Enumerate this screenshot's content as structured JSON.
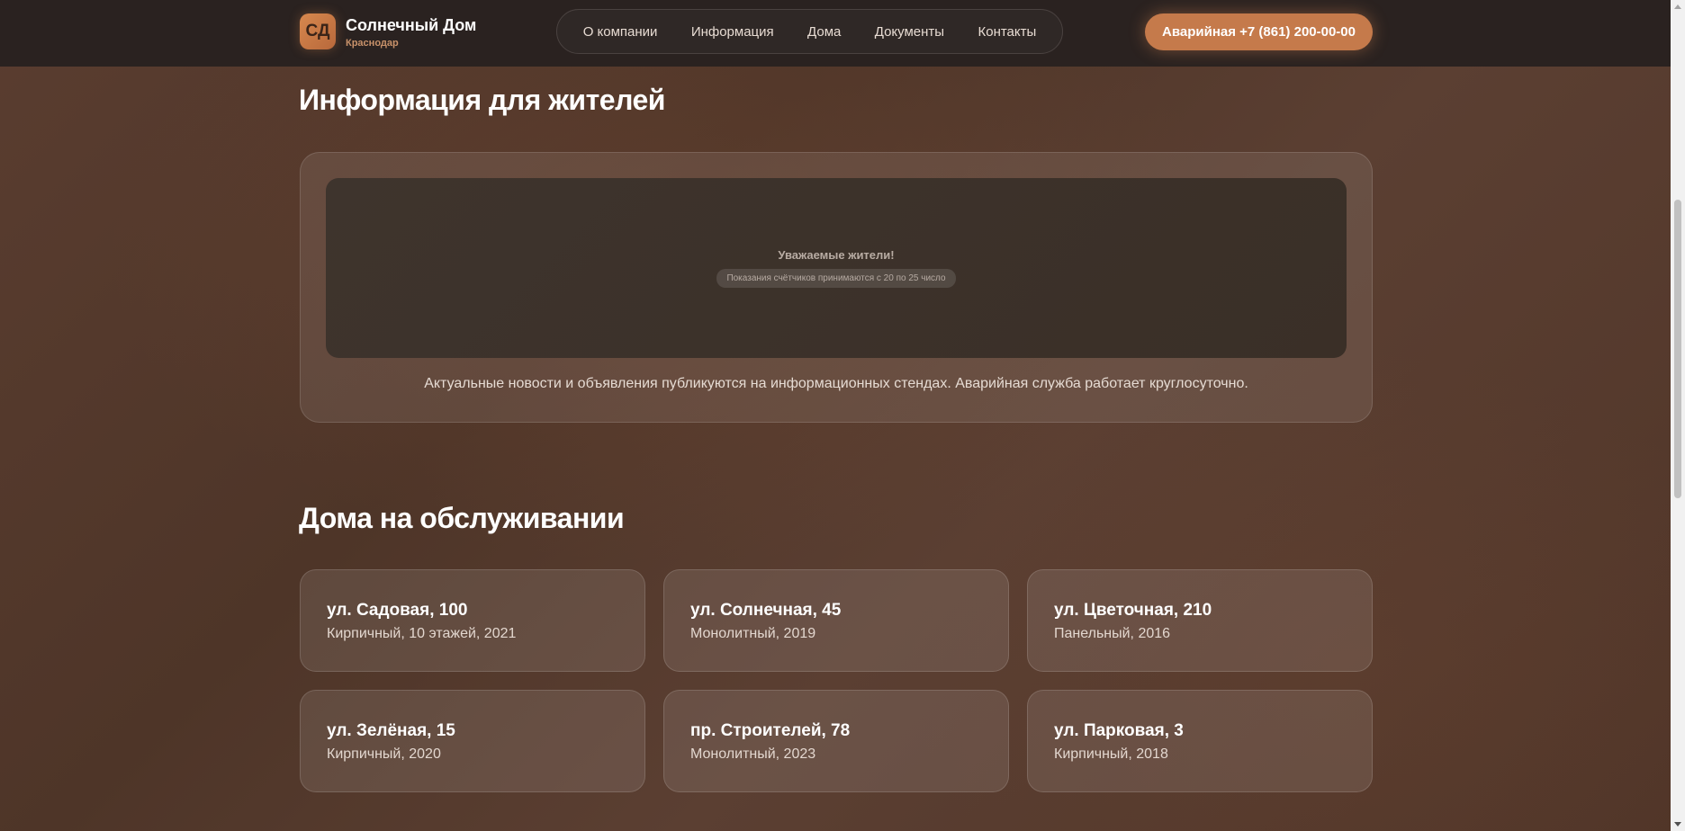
{
  "header": {
    "logo_text": "СД",
    "brand_name": "Солнечный Дом",
    "brand_city": "Краснодар",
    "nav": [
      "О компании",
      "Информация",
      "Дома",
      "Документы",
      "Контакты"
    ],
    "emergency_button": "Аварийная +7 (861) 200-00-00"
  },
  "info": {
    "title": "Информация для жителей",
    "banner_title": "Уважаемые жители!",
    "banner_badge": "Показания счётчиков принимаются с 20 по 25 число",
    "text": "Актуальные новости и объявления публикуются на информационных стендах. Аварийная служба работает круглосуточно."
  },
  "houses": {
    "title": "Дома на обслуживании",
    "items": [
      {
        "address": "ул. Садовая, 100",
        "desc": "Кирпичный, 10 этажей, 2021"
      },
      {
        "address": "ул. Солнечная, 45",
        "desc": "Монолитный, 2019"
      },
      {
        "address": "ул. Цветочная, 210",
        "desc": "Панельный, 2016"
      },
      {
        "address": "ул. Зелёная, 15",
        "desc": "Кирпичный, 2020"
      },
      {
        "address": "пр. Строителей, 78",
        "desc": "Монолитный, 2023"
      },
      {
        "address": "ул. Парковая, 3",
        "desc": "Кирпичный, 2018"
      }
    ]
  },
  "colors": {
    "accent": "#c57a4b",
    "header_bg": "#2a2220",
    "page_bg": "#553a2d"
  }
}
